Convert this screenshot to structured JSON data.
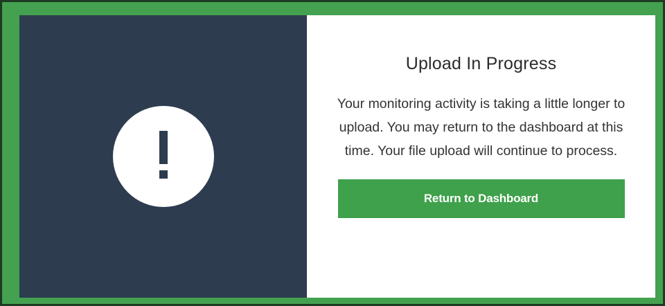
{
  "modal": {
    "title": "Upload In Progress",
    "message": "Your monitoring activity is taking a little longer to upload. You may return to the dashboard at this time. Your file upload will continue to process.",
    "button_label": "Return to Dashboard",
    "icon": "exclamation-circle-icon",
    "colors": {
      "accent": "#3fa14b",
      "panel_dark": "#2d3c4f",
      "background": "#ffffff"
    }
  }
}
